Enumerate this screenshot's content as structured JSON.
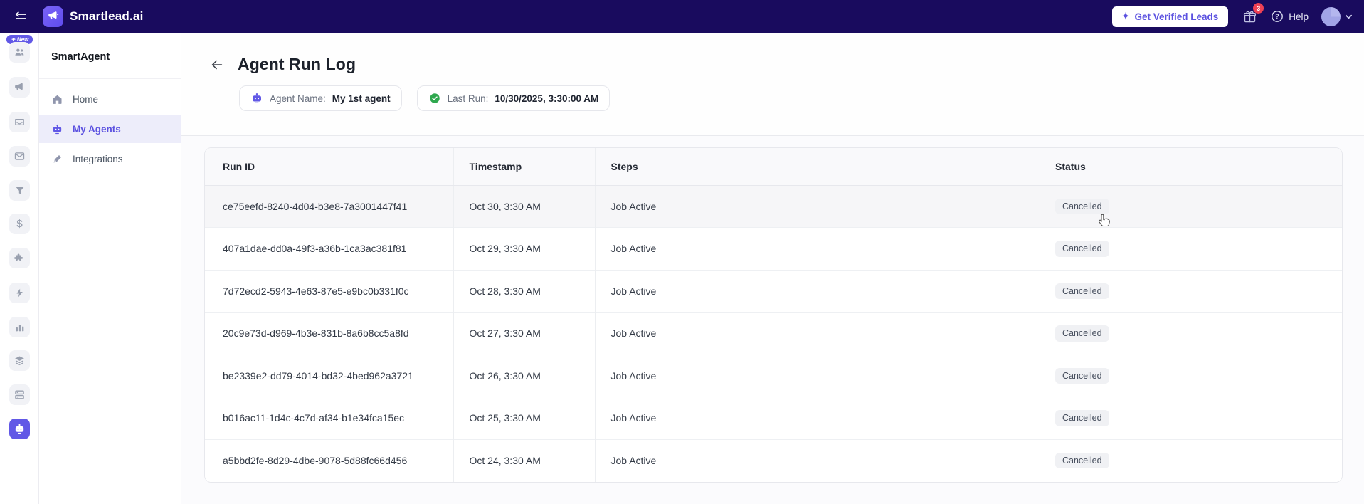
{
  "topbar": {
    "brand": "Smartlead.ai",
    "verified_leads_button": {
      "icon_glyph": "✦",
      "label": "Get Verified Leads"
    },
    "gift_badge_count": "3",
    "help_label": "Help"
  },
  "rail": {
    "new_badge_label": "✦ New",
    "icons": [
      "users",
      "megaphone",
      "inbox",
      "envelope",
      "funnel",
      "dollar",
      "puzzle",
      "lightning",
      "bar-chart",
      "layers",
      "server",
      "smartagent-robot"
    ],
    "active_icon": "smartagent-robot"
  },
  "sidebar": {
    "title": "SmartAgent",
    "items": [
      {
        "label": "Home",
        "icon": "home-icon",
        "active": false
      },
      {
        "label": "My Agents",
        "icon": "robot-icon",
        "active": true
      },
      {
        "label": "Integrations",
        "icon": "pen-icon",
        "active": false
      }
    ]
  },
  "page": {
    "title": "Agent Run Log",
    "chips": {
      "agent_name_label": "Agent Name:",
      "agent_name_value": "My 1st agent",
      "last_run_label": "Last Run:",
      "last_run_value": "10/30/2025, 3:30:00 AM"
    }
  },
  "table": {
    "columns": [
      "Run ID",
      "Timestamp",
      "Steps",
      "Status"
    ],
    "highlighted_row_index": 0,
    "rows": [
      {
        "run_id": "ce75eefd-8240-4d04-b3e8-7a3001447f41",
        "timestamp": "Oct 30, 3:30 AM",
        "steps": "Job Active",
        "status": "Cancelled"
      },
      {
        "run_id": "407a1dae-dd0a-49f3-a36b-1ca3ac381f81",
        "timestamp": "Oct 29, 3:30 AM",
        "steps": "Job Active",
        "status": "Cancelled"
      },
      {
        "run_id": "7d72ecd2-5943-4e63-87e5-e9bc0b331f0c",
        "timestamp": "Oct 28, 3:30 AM",
        "steps": "Job Active",
        "status": "Cancelled"
      },
      {
        "run_id": "20c9e73d-d969-4b3e-831b-8a6b8cc5a8fd",
        "timestamp": "Oct 27, 3:30 AM",
        "steps": "Job Active",
        "status": "Cancelled"
      },
      {
        "run_id": "be2339e2-dd79-4014-bd32-4bed962a3721",
        "timestamp": "Oct 26, 3:30 AM",
        "steps": "Job Active",
        "status": "Cancelled"
      },
      {
        "run_id": "b016ac11-1d4c-4c7d-af34-b1e34fca15ec",
        "timestamp": "Oct 25, 3:30 AM",
        "steps": "Job Active",
        "status": "Cancelled"
      },
      {
        "run_id": "a5bbd2fe-8d29-4dbe-9078-5d88fc66d456",
        "timestamp": "Oct 24, 3:30 AM",
        "steps": "Job Active",
        "status": "Cancelled"
      }
    ]
  },
  "colors": {
    "topbar_bg": "#190b5e",
    "accent_purple": "#6158e6",
    "active_text": "#5b51e0",
    "success_green": "#2fa84f",
    "notification_red": "#ef4155",
    "status_badge_bg": "#f0f1f4",
    "status_badge_text": "#454d5c"
  }
}
